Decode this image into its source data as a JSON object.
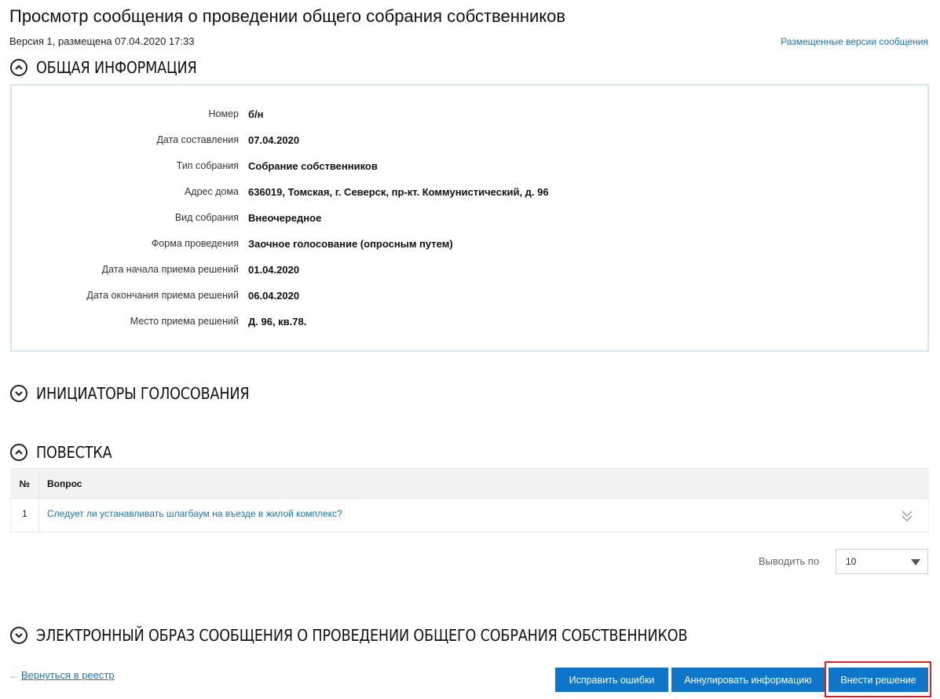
{
  "page": {
    "title": "Просмотр сообщения о проведении общего собрания собственников",
    "version_text": "Версия 1, размещена 07.04.2020 17:33",
    "versions_link": "Размещенные версии сообщения"
  },
  "sections": {
    "general": "ОБЩАЯ ИНФОРМАЦИЯ",
    "initiators": "ИНИЦИАТОРЫ ГОЛОСОВАНИЯ",
    "agenda": "ПОВЕСТКА",
    "electronic": "ЭЛЕКТРОННЫЙ ОБРАЗ СООБЩЕНИЯ О ПРОВЕДЕНИИ ОБЩЕГО СОБРАНИЯ СОБСТВЕННИКОВ"
  },
  "general_info": [
    {
      "label": "Номер",
      "value": "б/н"
    },
    {
      "label": "Дата составления",
      "value": "07.04.2020"
    },
    {
      "label": "Тип собрания",
      "value": "Собрание собственников"
    },
    {
      "label": "Адрес дома",
      "value": "636019, Томская, г. Северск, пр-кт. Коммунистический, д. 96"
    },
    {
      "label": "Вид собрания",
      "value": "Внеочередное"
    },
    {
      "label": "Форма проведения",
      "value": "Заочное голосование (опросным путем)"
    },
    {
      "label": "Дата начала приема решений",
      "value": "01.04.2020"
    },
    {
      "label": "Дата окончания приема решений",
      "value": "06.04.2020"
    },
    {
      "label": "Место приема решений",
      "value": "Д. 96, кв.78."
    }
  ],
  "agenda": {
    "columns": {
      "num": "№",
      "question": "Вопрос"
    },
    "rows": [
      {
        "num": "1",
        "question": "Следует ли устанавливать шлагбаум на въезде в жилой комплекс?"
      }
    ]
  },
  "pagination": {
    "label": "Выводить по",
    "selected": "10"
  },
  "footer": {
    "back_link": "Вернуться в реестр",
    "fix_button": "Исправить ошибки",
    "annul_button": "Аннулировать информацию",
    "decision_button": "Внести решение"
  },
  "colors": {
    "accent": "#0f75c8",
    "link": "#1a73b8",
    "highlight": "#e02020"
  }
}
